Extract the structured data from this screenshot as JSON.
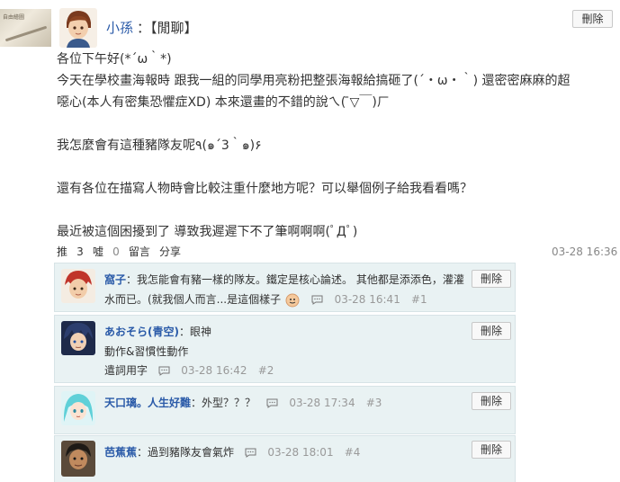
{
  "post": {
    "author": "小孫",
    "separator": "：",
    "category": "【閒聊】",
    "delete_label": "刪除",
    "body": [
      "各位下午好(*´ω｀*)",
      "今天在學校畫海報時 跟我一組的同學用亮粉把整張海報給搞砸了(´・ω・｀) 還密密麻麻的超",
      "噁心(本人有密集恐懼症XD) 本來還畫的不錯的說ㄟ(  ̄▽￣)ㄏ",
      "",
      "我怎麼會有這種豬隊友呢٩(๑´3｀๑)۶",
      "",
      "還有各位在描寫人物時會比較注重什麼地方呢？可以舉個例子給我看看嗎？",
      "",
      "最近被這個困擾到了 導致我遲遲下不了筆啊啊啊(ﾟДﾟ)"
    ],
    "actions": {
      "push_label": "推",
      "push_count": "3",
      "boo_label": "噓",
      "boo_count": "0",
      "reply_label": "留言",
      "share_label": "分享"
    },
    "timestamp": "03-28 16:36"
  },
  "comments": [
    {
      "name": "窩子",
      "text_line1": "：我怎能會有豬一樣的隊友。鐵定是核心論述。 其他都是添添色，灌灌",
      "text_line2": "水而已。(就我個人而言...是這個樣子",
      "time": "03-28 16:41",
      "floor": "#1",
      "delete_label": "刪除"
    },
    {
      "name": "あおそら(青空)",
      "text_line1": "：眼神",
      "text_line2": "動作&習慣性動作",
      "text_line3": "遣詞用字",
      "time": "03-28 16:42",
      "floor": "#2",
      "delete_label": "刪除"
    },
    {
      "name": "天口璃。人生好難",
      "text_line1": "：外型？？？",
      "time": "03-28 17:34",
      "floor": "#3",
      "delete_label": "刪除"
    },
    {
      "name": "芭蕉蕉",
      "text_line1": "：過到豬隊友會氣炸",
      "time": "03-28 18:01",
      "floor": "#4",
      "delete_label": "刪除"
    }
  ],
  "colors": {
    "author": "#2a5aa8",
    "comment_bg": "#e9f2f3",
    "muted": "#888888"
  }
}
